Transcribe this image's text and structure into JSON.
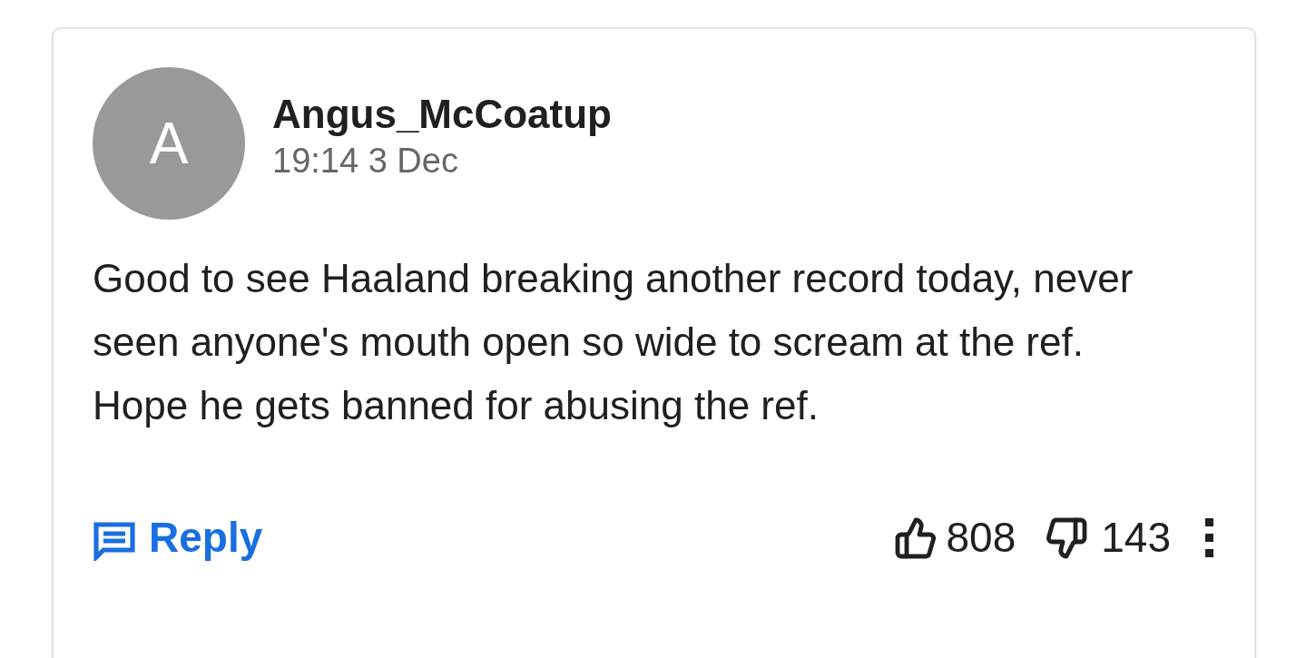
{
  "comment": {
    "avatar_letter": "A",
    "author": "Angus_McCoatup",
    "time": "19:14 3 Dec",
    "paragraphs": [
      "Good to see Haaland breaking another record today, never seen anyone's mouth open so wide to scream at the ref.",
      "Hope he gets banned for abusing the ref."
    ],
    "reply_label": "Reply",
    "likes": "808",
    "dislikes": "143"
  }
}
